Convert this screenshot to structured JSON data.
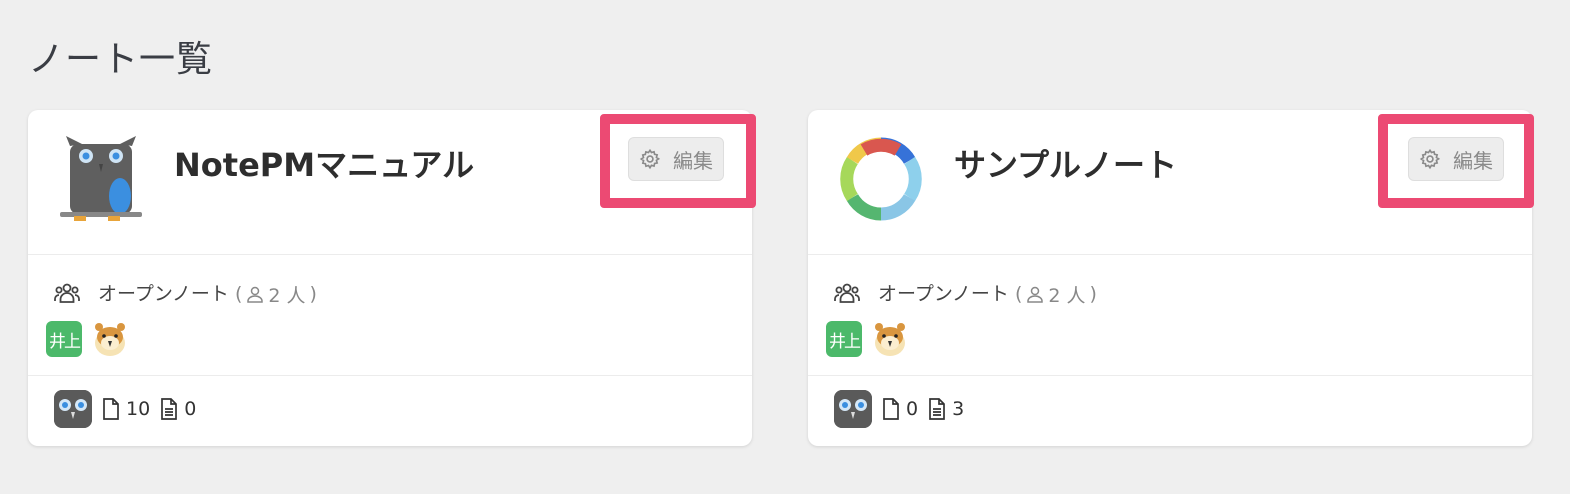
{
  "page_title": "ノート一覧",
  "notes": [
    {
      "title": "NotePMマニュアル",
      "edit_label": "編集",
      "access_label": "オープンノート",
      "member_count": "2 人",
      "member_initials": "井上",
      "page_count": "10",
      "template_count": "0"
    },
    {
      "title": "サンプルノート",
      "edit_label": "編集",
      "access_label": "オープンノート",
      "member_count": "2 人",
      "member_initials": "井上",
      "page_count": "0",
      "template_count": "3"
    }
  ],
  "colors": {
    "highlight": "#ec4a73",
    "initials_avatar": "#4cb96a",
    "background": "#efefef"
  },
  "icons": [
    "gear-icon",
    "group-icon",
    "person-icon",
    "page-icon",
    "template-icon",
    "owl-logo",
    "donut-logo",
    "hamster-avatar"
  ]
}
